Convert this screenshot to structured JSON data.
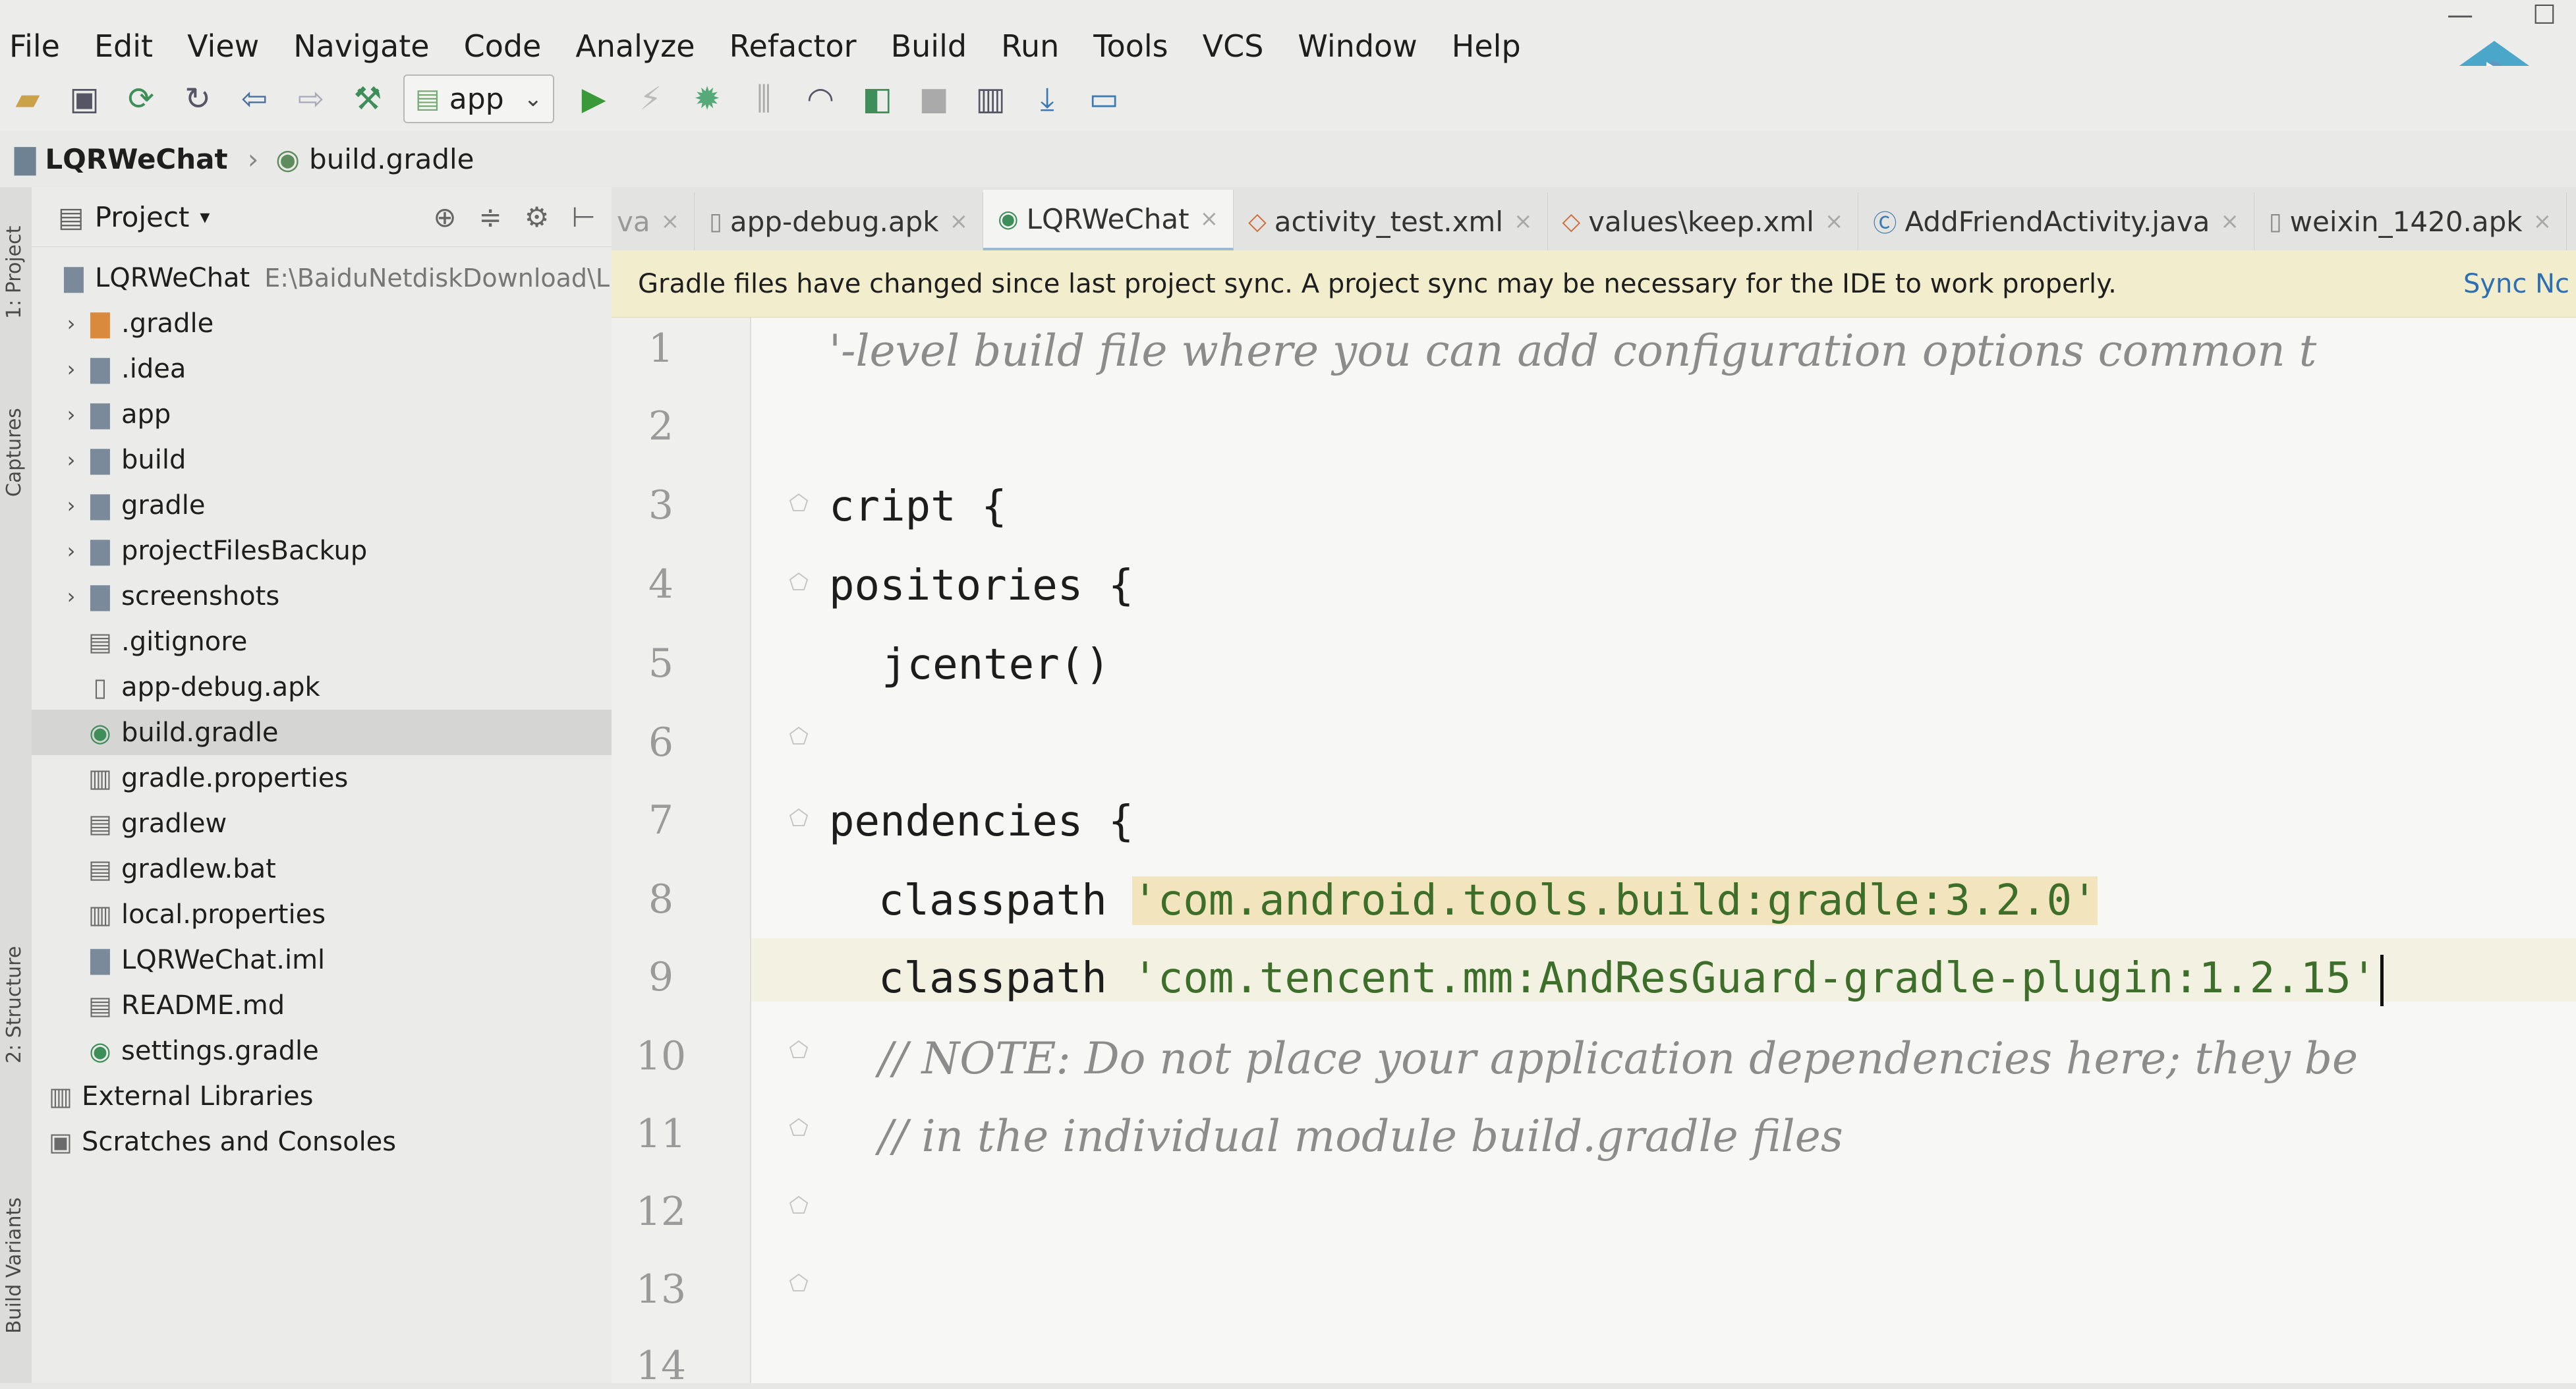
{
  "menu": [
    "File",
    "Edit",
    "View",
    "Navigate",
    "Code",
    "Analyze",
    "Refactor",
    "Build",
    "Run",
    "Tools",
    "VCS",
    "Window",
    "Help"
  ],
  "toolbar": {
    "config_selector": "app",
    "icons": [
      "open-folder-icon",
      "save-icon",
      "sync-icon",
      "refresh-icon",
      "back-icon",
      "forward-icon",
      "hammer-icon",
      "run-icon",
      "apply-changes-icon",
      "debug-icon",
      "attach-debugger-icon",
      "profile-icon",
      "coverage-icon",
      "stop-icon",
      "sdk-manager-icon",
      "download-icon",
      "device-manager-icon"
    ]
  },
  "breadcrumbs": [
    "LQRWeChat",
    "build.gradle"
  ],
  "tool_windows": {
    "project": "1: Project",
    "captures": "Captures",
    "structure": "2: Structure",
    "build_variants": "Build Variants"
  },
  "project_panel": {
    "title": "Project",
    "root_name": "LQRWeChat",
    "root_path": "E:\\BaiduNetdiskDownload\\L",
    "items": [
      {
        "label": ".gradle",
        "icon": "folder-orange"
      },
      {
        "label": ".idea",
        "icon": "folder"
      },
      {
        "label": "app",
        "icon": "module-folder"
      },
      {
        "label": "build",
        "icon": "folder"
      },
      {
        "label": "gradle",
        "icon": "folder"
      },
      {
        "label": "projectFilesBackup",
        "icon": "folder"
      },
      {
        "label": "screenshots",
        "icon": "folder"
      },
      {
        "label": ".gitignore",
        "icon": "file"
      },
      {
        "label": "app-debug.apk",
        "icon": "apk"
      },
      {
        "label": "build.gradle",
        "icon": "gradle"
      },
      {
        "label": "gradle.properties",
        "icon": "properties"
      },
      {
        "label": "gradlew",
        "icon": "file"
      },
      {
        "label": "gradlew.bat",
        "icon": "file"
      },
      {
        "label": "local.properties",
        "icon": "properties"
      },
      {
        "label": "LQRWeChat.iml",
        "icon": "iml"
      },
      {
        "label": "README.md",
        "icon": "file"
      },
      {
        "label": "settings.gradle",
        "icon": "gradle"
      },
      {
        "label": "External Libraries",
        "icon": "libraries"
      },
      {
        "label": "Scratches and Consoles",
        "icon": "scratches"
      }
    ]
  },
  "tabs": [
    {
      "label": "va"
    },
    {
      "label": "app-debug.apk"
    },
    {
      "label": "LQRWeChat"
    },
    {
      "label": "activity_test.xml"
    },
    {
      "label": "values\\keep.xml"
    },
    {
      "label": "AddFriendActivity.java"
    },
    {
      "label": "weixin_1420.apk"
    }
  ],
  "banner": {
    "message": "Gradle files have changed since last project sync. A project sync may be necessary for the IDE to work properly.",
    "action": "Sync Nc"
  },
  "editor": {
    "line_numbers": [
      "1",
      "2",
      "3",
      "4",
      "5",
      "6",
      "7",
      "8",
      "9",
      "10",
      "11",
      "12",
      "13",
      "14"
    ],
    "line1": "'-level build file where you can add configuration options common t",
    "line3": "cript {",
    "line4": "positories {",
    "line5": "jcenter()",
    "line7": "pendencies {",
    "line8_kw": "classpath ",
    "line8_str": "'com.android.tools.build:gradle:3.2.0'",
    "line9_kw": "classpath ",
    "line9_str": "'com.tencent.mm:AndResGuard-gradle-plugin:1.2.15'",
    "line10": "// NOTE: Do not place your application dependencies here; they be",
    "line11": "// in the individual module build.gradle files"
  },
  "colors": {
    "accent": "#2d6fb4",
    "string": "#3d6e2a",
    "comment": "#8c8c8c",
    "banner": "#f1edcd"
  }
}
